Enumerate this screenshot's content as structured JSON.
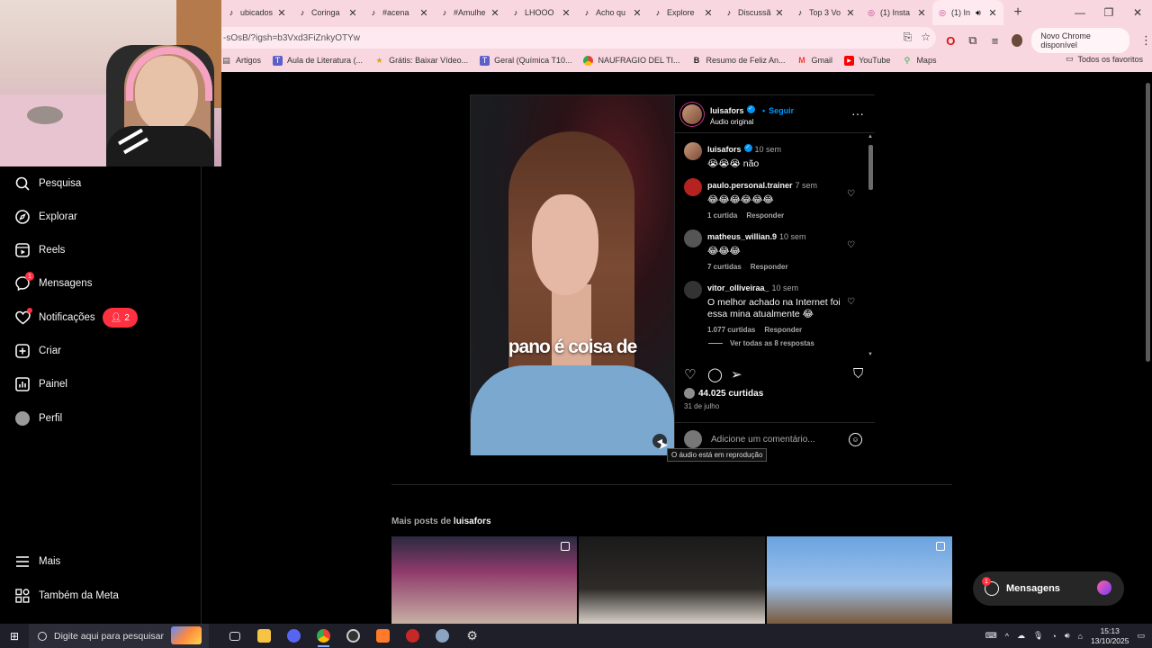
{
  "browser": {
    "tabs": [
      {
        "title": "ubicados",
        "icon": "tiktok-icon"
      },
      {
        "title": "Coringa",
        "icon": "tiktok-icon"
      },
      {
        "title": "#acena",
        "icon": "tiktok-icon"
      },
      {
        "title": "#Amulhe",
        "icon": "tiktok-icon"
      },
      {
        "title": "LHOOO",
        "icon": "tiktok-icon"
      },
      {
        "title": "Acho qu",
        "icon": "tiktok-icon"
      },
      {
        "title": "Explore",
        "icon": "tiktok-icon"
      },
      {
        "title": "Discussã",
        "icon": "tiktok-icon"
      },
      {
        "title": "Top 3 Vo",
        "icon": "tiktok-icon"
      },
      {
        "title": "(1) Insta",
        "icon": "instagram-icon"
      },
      {
        "title": "(1) In",
        "icon": "instagram-icon",
        "active": true
      }
    ],
    "url": "-sOsB/?igsh=b3Vxd3FiZnkyOTYw",
    "update_button": "Novo Chrome disponível",
    "bookmarks": [
      {
        "label": "Artigos",
        "icon": "folder-icon"
      },
      {
        "label": "Aula de Literatura (...",
        "icon": "teams-icon"
      },
      {
        "label": "Grátis: Baixar Vídeo...",
        "icon": "star-icon"
      },
      {
        "label": "Geral (Química T10...",
        "icon": "teams-icon"
      },
      {
        "label": "NAUFRAGIO DEL TI...",
        "icon": "chrome-icon"
      },
      {
        "label": "Resumo de Feliz An...",
        "icon": "bold-b-icon"
      },
      {
        "label": "Gmail",
        "icon": "gmail-icon"
      },
      {
        "label": "YouTube",
        "icon": "youtube-icon"
      },
      {
        "label": "Maps",
        "icon": "maps-icon"
      }
    ],
    "all_bookmarks": "Todos os favoritos"
  },
  "nav": {
    "items": [
      {
        "label": "Pesquisa",
        "icon": "search-icon"
      },
      {
        "label": "Explorar",
        "icon": "compass-icon"
      },
      {
        "label": "Reels",
        "icon": "reels-icon"
      },
      {
        "label": "Mensagens",
        "icon": "messenger-icon",
        "badge": "1"
      },
      {
        "label": "Notificações",
        "icon": "heart-icon"
      },
      {
        "label": "Criar",
        "icon": "plus-square-icon"
      },
      {
        "label": "Painel",
        "icon": "chart-icon"
      },
      {
        "label": "Perfil",
        "icon": "avatar"
      }
    ],
    "notif_count": "2",
    "bottom": [
      {
        "label": "Mais",
        "icon": "menu-icon"
      },
      {
        "label": "Também da Meta",
        "icon": "meta-grid-icon"
      }
    ]
  },
  "post": {
    "video_caption": "pano é coisa de",
    "author": "luisafors",
    "follow": "Seguir",
    "dot": "•",
    "audio": "Áudio original",
    "caption_text": "😭😭😭 não",
    "caption_time": "10 sem",
    "comments": [
      {
        "user": "paulo.personal.trainer",
        "time": "7 sem",
        "text": "😂😂😂😂😂😂",
        "likes": "1 curtida",
        "reply": "Responder"
      },
      {
        "user": "matheus_willian.9",
        "time": "10 sem",
        "text": "😂😂😂",
        "likes": "7 curtidas",
        "reply": "Responder"
      },
      {
        "user": "vitor_olliveiraa_",
        "time": "10 sem",
        "text": "O melhor achado na Internet foi essa mina atualmente 😂",
        "likes": "1.077 curtidas",
        "reply": "Responder"
      }
    ],
    "view_replies": "Ver todas as 8 respostas",
    "like_count": "44.025 curtidas",
    "date": "31 de julho",
    "add_comment_placeholder": "Adicione um comentário...",
    "tooltip": "O áudio está em reprodução"
  },
  "more_posts": {
    "prefix": "Mais posts de",
    "user": "luisafors"
  },
  "messages_pill": {
    "label": "Mensagens",
    "badge": "1"
  },
  "taskbar": {
    "search_placeholder": "Digite aqui para pesquisar",
    "time": "15:13",
    "date": "13/10/2025"
  }
}
